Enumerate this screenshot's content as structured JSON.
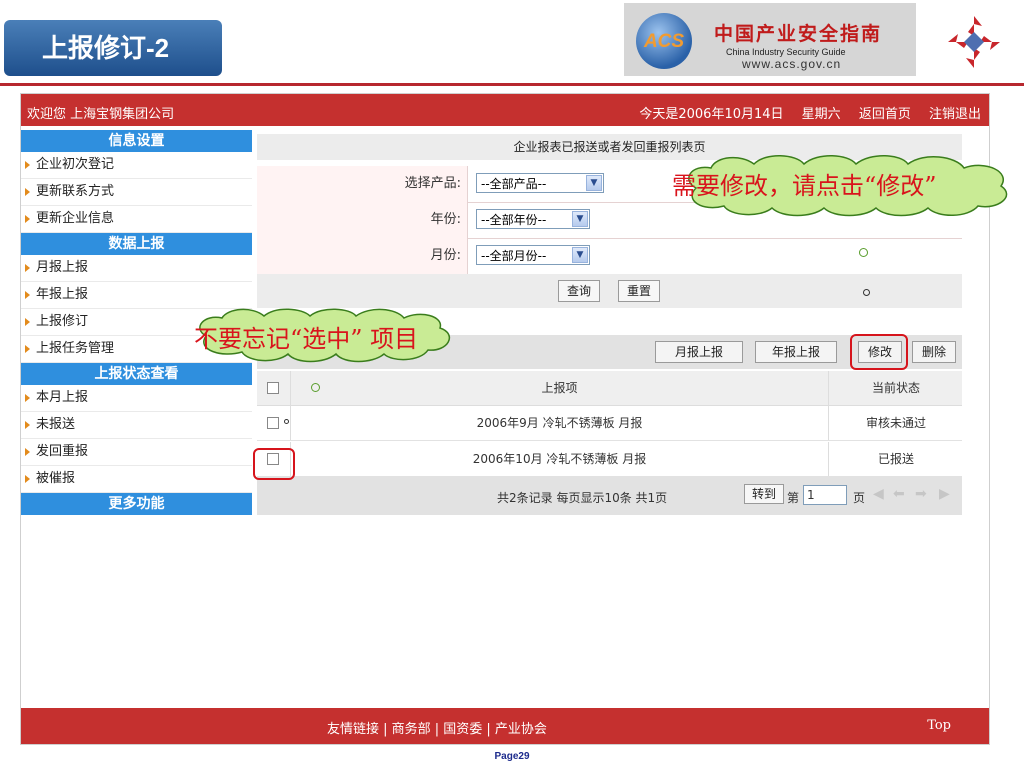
{
  "slide": {
    "title": "上报修订-2",
    "page": "Page29"
  },
  "logo": {
    "mark": "ACS",
    "cn": "中国产业安全指南",
    "en": "China  Industry  Security  Guide",
    "url": "www.acs.gov.cn"
  },
  "topbar": {
    "welcome": "欢迎您 上海宝钢集团公司",
    "date": "今天是2006年10月14日",
    "weekday": "星期六",
    "home": "返回首页",
    "logout": "注销退出"
  },
  "sidebar": {
    "sections": [
      {
        "title": "信息设置",
        "items": [
          "企业初次登记",
          "更新联系方式",
          "更新企业信息"
        ]
      },
      {
        "title": "数据上报",
        "items": [
          "月报上报",
          "年报上报",
          "上报修订",
          "上报任务管理"
        ]
      },
      {
        "title": "上报状态查看",
        "items": [
          "本月上报",
          "未报送",
          "发回重报",
          "被催报"
        ]
      },
      {
        "title": "更多功能",
        "items": []
      }
    ]
  },
  "panel": {
    "title": "企业报表已报送或者发回重报列表页",
    "product_label": "选择产品:",
    "product_value": "--全部产品--",
    "year_label": "年份:",
    "year_value": "--全部年份--",
    "month_label": "月份:",
    "month_value": "--全部月份--",
    "query": "查询",
    "reset": "重置"
  },
  "toolbar": {
    "monthly": "月报上报",
    "yearly": "年报上报",
    "modify": "修改",
    "delete": "删除"
  },
  "table": {
    "headers": {
      "item": "上报项",
      "status": "当前状态"
    },
    "rows": [
      {
        "item": "2006年9月 冷轧不锈薄板 月报",
        "status": "审核未通过"
      },
      {
        "item": "2006年10月 冷轧不锈薄板 月报",
        "status": "已报送"
      }
    ]
  },
  "pager": {
    "summary": "共2条记录   每页显示10条   共1页",
    "goto": "转到",
    "page_prefix": "第",
    "page_value": "1",
    "page_suffix": "页"
  },
  "footer": {
    "links": "友情链接 | 商务部 | 国资委 | 产业协会",
    "top": "Top"
  },
  "annotations": {
    "modify_hint": "需要修改，请点击“修改”",
    "select_hint": "不要忘记“选中” 项目"
  },
  "colors": {
    "brand_red": "#c5302f",
    "sidebar_blue": "#2f8fde",
    "annotation_red": "#d9141c"
  }
}
